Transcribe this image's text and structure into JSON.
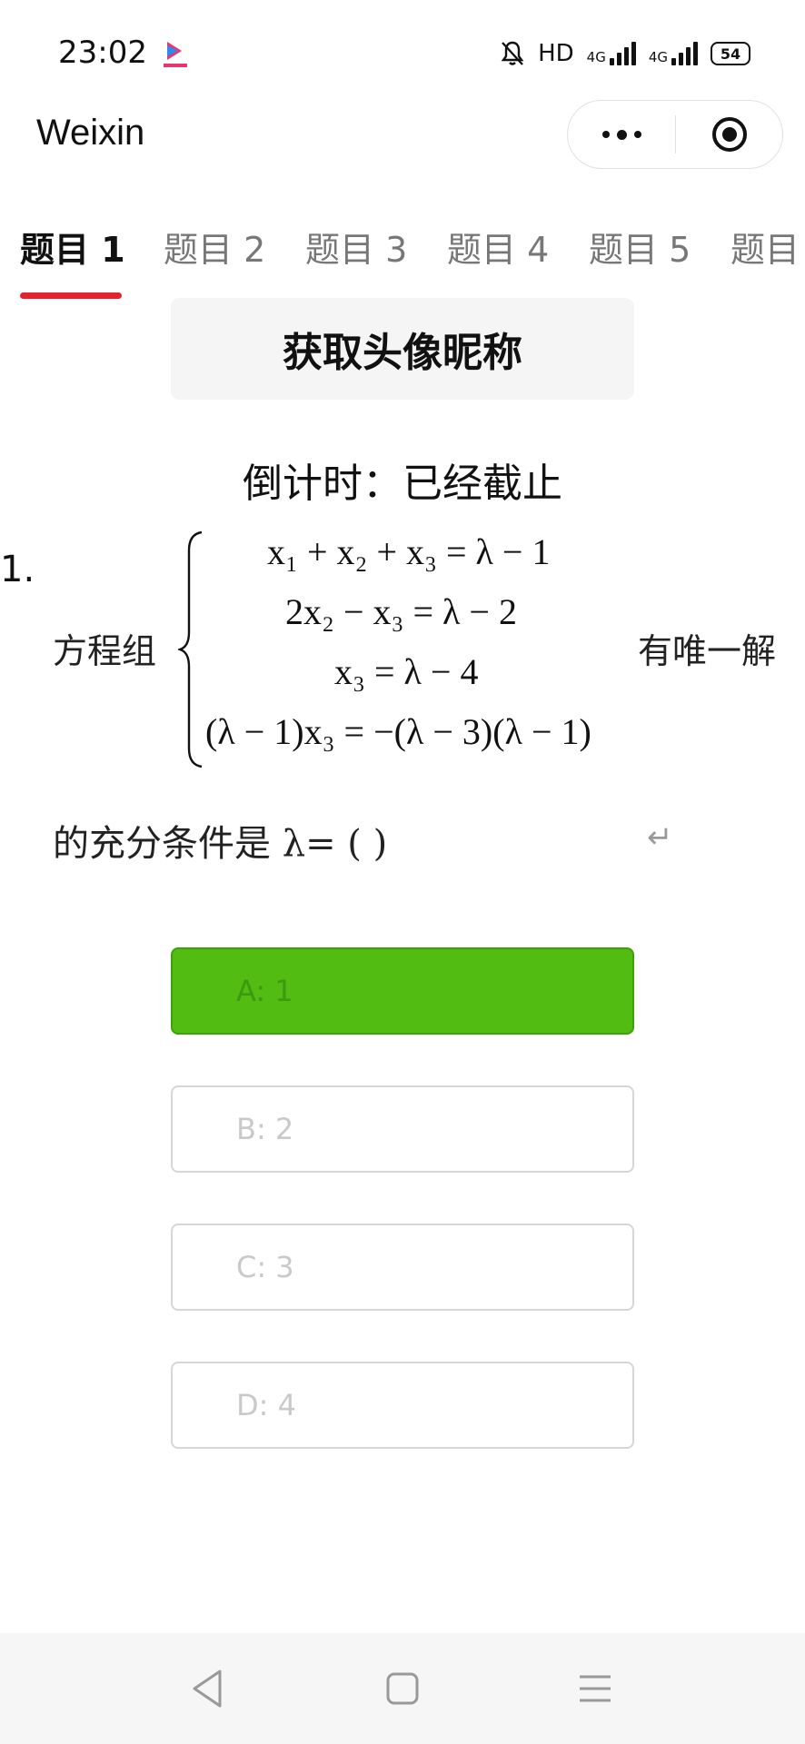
{
  "status_bar": {
    "time": "23:02",
    "app_icon": "youku-icon",
    "hd_label": "HD",
    "network_1": "4G",
    "network_2": "4G",
    "battery": "54"
  },
  "header": {
    "title": "Weixin",
    "more_icon": "more-dots-icon",
    "close_icon": "target-close-icon"
  },
  "tabs": [
    {
      "label": "题目 1",
      "active": true
    },
    {
      "label": "题目 2",
      "active": false
    },
    {
      "label": "题目 3",
      "active": false
    },
    {
      "label": "题目 4",
      "active": false
    },
    {
      "label": "题目 5",
      "active": false
    },
    {
      "label": "题目",
      "active": false
    }
  ],
  "get_profile_button": "获取头像昵称",
  "countdown": "倒计时：已经截止",
  "question": {
    "number": "1.",
    "prefix": "方程组",
    "suffix": "有唯一解",
    "equations": [
      "x₁ + x₂ + x₃ = λ − 1",
      "2x₂ − x₃ = λ − 2",
      "x₃ = λ − 4",
      "(λ − 1)x₃ = −(λ − 3)(λ − 1)"
    ],
    "condition": "的充分条件是 λ= (   )",
    "return_mark": "↵"
  },
  "options": [
    {
      "label": "A: 1",
      "selected": true
    },
    {
      "label": "B: 2",
      "selected": false
    },
    {
      "label": "C: 3",
      "selected": false
    },
    {
      "label": "D: 4",
      "selected": false
    }
  ],
  "colors": {
    "accent_red": "#e3232f",
    "selected_green": "#52bc12"
  },
  "bottom_nav": {
    "back_icon": "back-triangle-icon",
    "home_icon": "home-square-icon",
    "menu_icon": "menu-lines-icon"
  }
}
